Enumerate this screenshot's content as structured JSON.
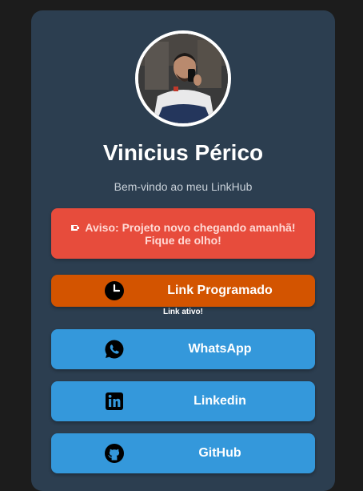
{
  "profile": {
    "name": "Vinicius Périco",
    "subtitle": "Bem-vindo ao meu LinkHub"
  },
  "notice": {
    "icon": "pushpin-icon",
    "text": "Aviso: Projeto novo chegando amanhã! Fique de olho!"
  },
  "links": {
    "scheduled": {
      "label": "Link Programado",
      "icon": "clock-icon",
      "status": "Link ativo!"
    },
    "whatsapp": {
      "label": "WhatsApp",
      "icon": "whatsapp-icon"
    },
    "linkedin": {
      "label": "Linkedin",
      "icon": "linkedin-icon"
    },
    "github": {
      "label": "GitHub",
      "icon": "github-icon"
    }
  },
  "colors": {
    "page_bg": "#1c1c1c",
    "card_bg": "#2c3e50",
    "notice_bg": "#e74c3c",
    "scheduled_bg": "#d35400",
    "link_bg": "#3498db"
  }
}
